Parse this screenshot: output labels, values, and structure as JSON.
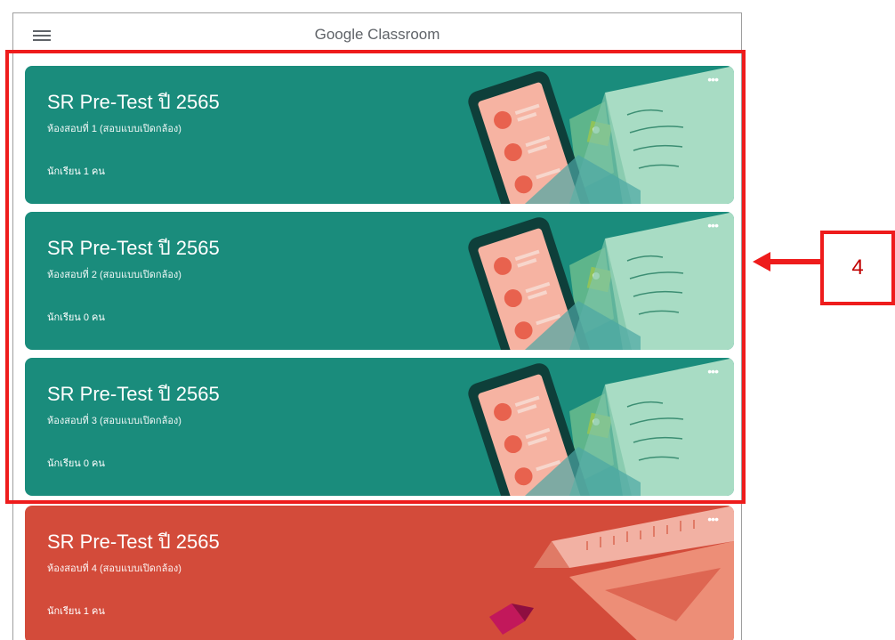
{
  "app": {
    "title": "Google Classroom",
    "menu_icon": "hamburger-menu-icon"
  },
  "classes": [
    {
      "title": "SR Pre-Test  ปี 2565",
      "section": "ห้องสอบที่ 1 (สอบแบบเปิดกล้อง)",
      "students": "นักเรียน 1 คน",
      "theme": "teal",
      "color": "#1a8c7c"
    },
    {
      "title": "SR Pre-Test  ปี 2565",
      "section": "ห้องสอบที่ 2 (สอบแบบเปิดกล้อง)",
      "students": "นักเรียน 0 คน",
      "theme": "teal",
      "color": "#1a8c7c"
    },
    {
      "title": "SR Pre-Test  ปี 2565",
      "section": "ห้องสอบที่ 3 (สอบแบบเปิดกล้อง)",
      "students": "นักเรียน 0 คน",
      "theme": "teal",
      "color": "#1a8c7c"
    },
    {
      "title": "SR Pre-Test  ปี 2565",
      "section": "ห้องสอบที่ 4 (สอบแบบเปิดกล้อง)",
      "students": "นักเรียน 1 คน",
      "theme": "red",
      "color": "#d34b3a"
    }
  ],
  "annotation": {
    "label": "4",
    "color": "#ee1c1c"
  }
}
